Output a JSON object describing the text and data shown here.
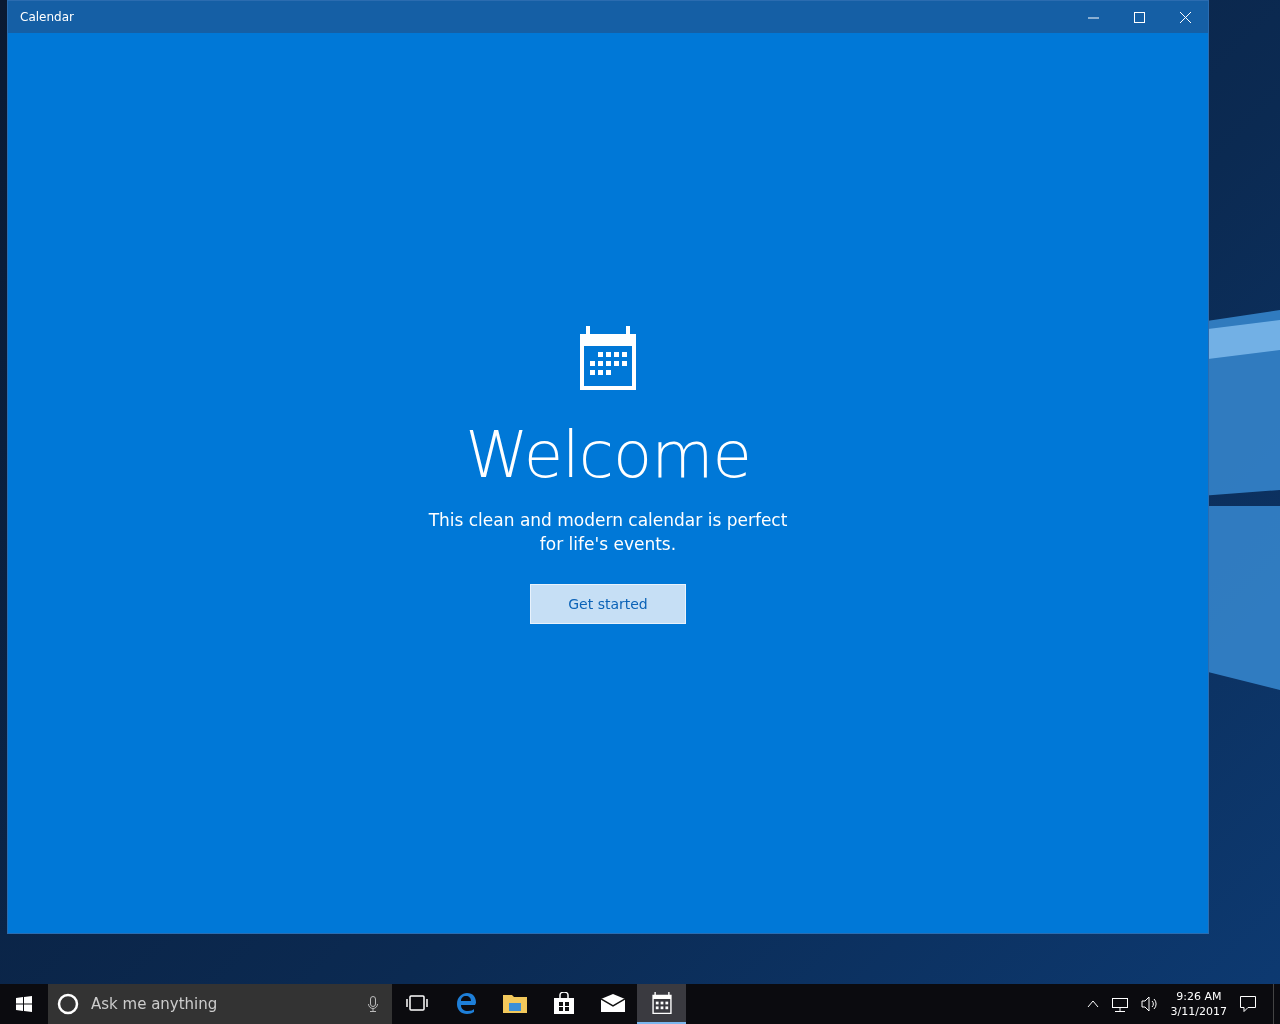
{
  "window": {
    "title": "Calendar"
  },
  "welcome": {
    "heading": "Welcome",
    "message": "This clean and modern calendar is perfect for life's events.",
    "button": "Get started"
  },
  "taskbar": {
    "search": {
      "placeholder": "Ask me anything"
    },
    "apps": [
      {
        "kind": "taskview",
        "selected": false
      },
      {
        "kind": "edge",
        "selected": false
      },
      {
        "kind": "explorer",
        "selected": false
      },
      {
        "kind": "store",
        "selected": false
      },
      {
        "kind": "mail",
        "selected": false
      },
      {
        "kind": "calendar",
        "selected": true
      }
    ],
    "clock": {
      "time": "9:26 AM",
      "date": "3/11/2017"
    }
  }
}
